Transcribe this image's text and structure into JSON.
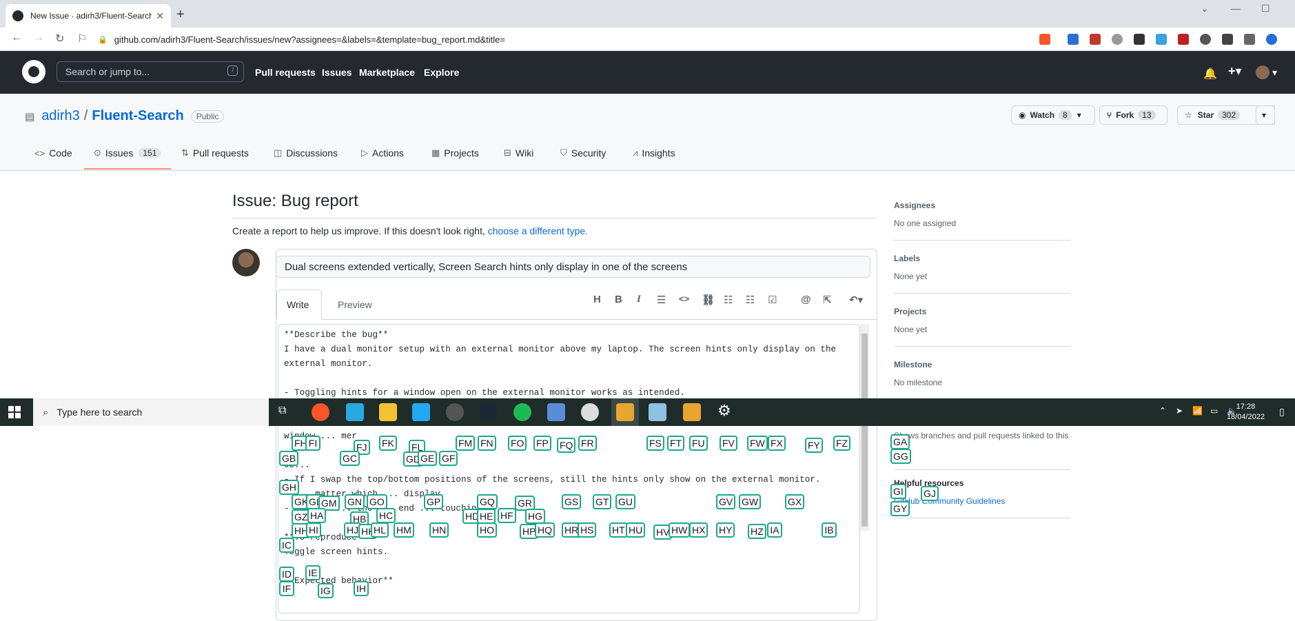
{
  "browser": {
    "tab_title": "New Issue · adirh3/Fluent-Search",
    "url": "github.com/adirh3/Fluent-Search/issues/new?assignees=&labels=&template=bug_report.md&title="
  },
  "github_header": {
    "search_placeholder": "Search or jump to...",
    "search_shortcut": "/",
    "nav": [
      "Pull requests",
      "Issues",
      "Marketplace",
      "Explore"
    ]
  },
  "repo": {
    "owner": "adirh3",
    "separator": "/",
    "name": "Fluent-Search",
    "visibility": "Public",
    "watch_label": "Watch",
    "watch_count": "8",
    "fork_label": "Fork",
    "fork_count": "13",
    "star_label": "Star",
    "star_count": "302",
    "tabs": [
      {
        "label": "Code",
        "icon": "code-icon"
      },
      {
        "label": "Issues",
        "count": "151",
        "icon": "issue-icon"
      },
      {
        "label": "Pull requests",
        "icon": "pull-request-icon"
      },
      {
        "label": "Discussions",
        "icon": "discussion-icon"
      },
      {
        "label": "Actions",
        "icon": "play-icon"
      },
      {
        "label": "Projects",
        "icon": "table-icon"
      },
      {
        "label": "Wiki",
        "icon": "book-icon"
      },
      {
        "label": "Security",
        "icon": "shield-icon"
      },
      {
        "label": "Insights",
        "icon": "graph-icon"
      }
    ]
  },
  "issue": {
    "heading": "Issue: Bug report",
    "description": "Create a report to help us improve. If this doesn't look right,",
    "description_link": "choose a different type.",
    "title_value": "Dual screens extended vertically, Screen Search hints only display in one of the screens",
    "tab_write": "Write",
    "tab_preview": "Preview",
    "body": "**Describe the bug**\nI have a dual monitor setup with an external monitor above my laptop. The screen hints only display on the\nexternal monitor.\n\n- Toggling hints for a window open on the external monitor works as intended.\n\n- If a window spans both screens, the hints from the ... display fine but the hints from the bottom part of\nwindow ... mer\n\nOb...\n- If I swap the top/bottom positions of the screens, still the hints only show on the external monitor.\n- ... matter which ... display\n- ... ues ... the ... end ... touching, ...\n\n**To reproduce**\nToggle screen hints.\n\n**Expected behavior**"
  },
  "sidebar": {
    "assignees_label": "Assignees",
    "assignees_value": "No one assigned",
    "labels_label": "Labels",
    "labels_value": "None yet",
    "projects_label": "Projects",
    "projects_value": "None yet",
    "milestone_label": "Milestone",
    "milestone_value": "No milestone",
    "linked_text": "Shows branches and pull requests linked to this",
    "helpful_label": "Helpful resources",
    "helpful_link": "GitHub Community Guidelines"
  },
  "taskbar": {
    "search_placeholder": "Type here to search",
    "time": "17:28",
    "date": "18/04/2022"
  },
  "colors": {
    "github_dark": "#24292f",
    "link": "#0969da",
    "hint_border": "#18a88a",
    "taskbar": "#1f2c29"
  },
  "hints": [
    "GA",
    "GG",
    "GI",
    "GJ",
    "GY",
    "FH",
    "FI",
    "FJ",
    "FK",
    "FL",
    "FM",
    "FN",
    "FO",
    "FP",
    "FQ",
    "FR",
    "FS",
    "FT",
    "FU",
    "FV",
    "FW",
    "FX",
    "FY",
    "FZ",
    "GB",
    "GC",
    "GD",
    "GE",
    "GF",
    "GH",
    "GK",
    "GL",
    "GM",
    "GN",
    "GO",
    "GP",
    "GQ",
    "GR",
    "GS",
    "GT",
    "GU",
    "GV",
    "GW",
    "GX",
    "GZ",
    "HA",
    "HB",
    "HC",
    "HD",
    "HE",
    "HF",
    "HG",
    "HH",
    "HI",
    "HJ",
    "HK",
    "HL",
    "HM",
    "HN",
    "HO",
    "HP",
    "HQ",
    "HR",
    "HS",
    "HT",
    "HU",
    "HV",
    "HW",
    "HX",
    "HY",
    "HZ",
    "IA",
    "IB",
    "IC",
    "ID",
    "IE",
    "IF",
    "IG",
    "IH"
  ]
}
